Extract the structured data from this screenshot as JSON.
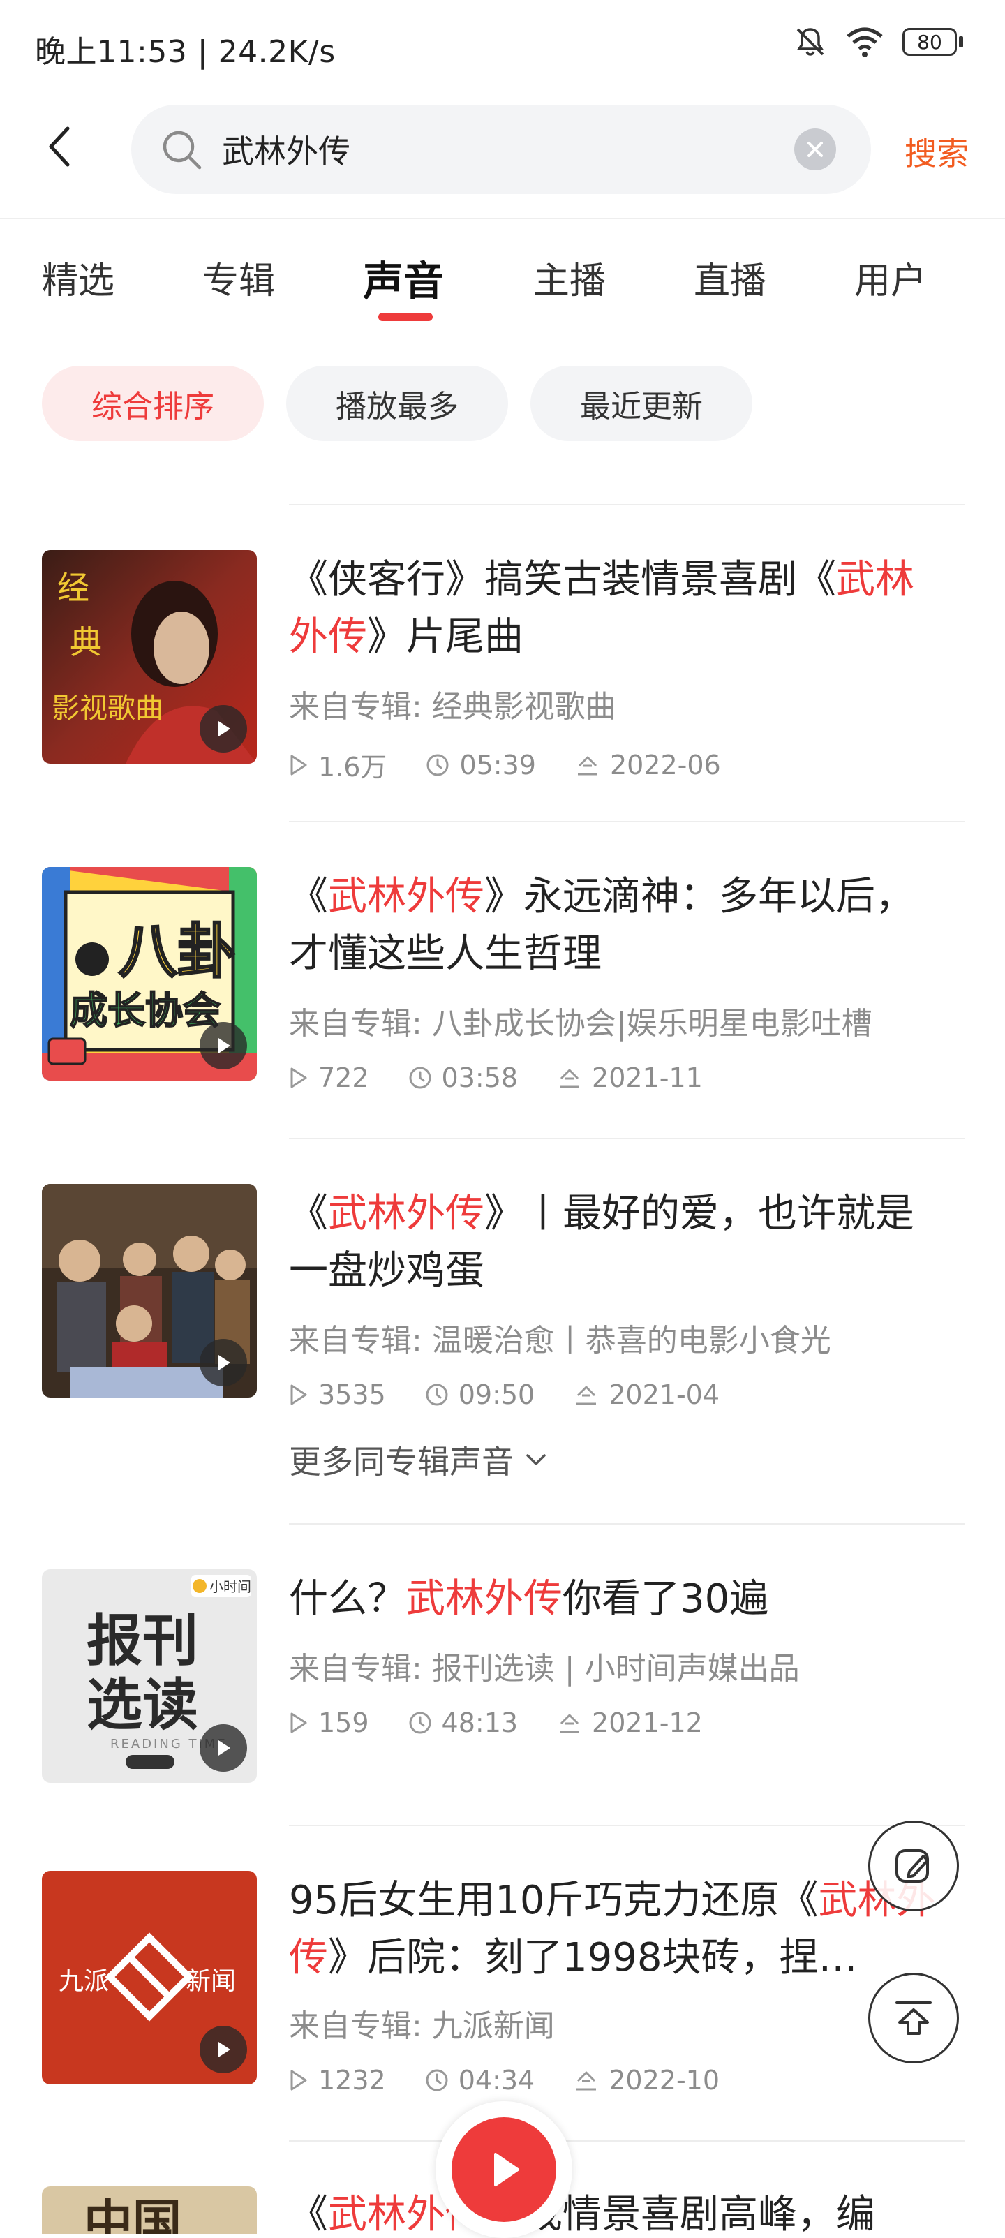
{
  "status_bar": {
    "time": "晚上11:53 | 24.2K/s",
    "battery": "80"
  },
  "search": {
    "query": "武林外传",
    "button": "搜索"
  },
  "tabs": [
    {
      "label": "精选",
      "active": false
    },
    {
      "label": "专辑",
      "active": false
    },
    {
      "label": "声音",
      "active": true
    },
    {
      "label": "主播",
      "active": false
    },
    {
      "label": "直播",
      "active": false
    },
    {
      "label": "用户",
      "active": false
    }
  ],
  "sort_chips": [
    {
      "label": "综合排序",
      "active": true
    },
    {
      "label": "播放最多",
      "active": false
    },
    {
      "label": "最近更新",
      "active": false
    }
  ],
  "tracks": [
    {
      "title_parts": [
        "《侠客行》搞笑古装情景喜剧《",
        "武林外传",
        "》片尾曲"
      ],
      "album": "来自专辑: 经典影视歌曲",
      "plays": "1.6万",
      "duration": "05:39",
      "date": "2022-06",
      "thumb_text": [
        "经",
        "典",
        "影视歌曲"
      ]
    },
    {
      "title_parts": [
        "《",
        "武林外传",
        "》永远滴神：多年以后，才懂这些人生哲理"
      ],
      "album": "来自专辑: 八卦成长协会|娱乐明星电影吐槽",
      "plays": "722",
      "duration": "03:58",
      "date": "2021-11",
      "thumb_text": [
        "八卦",
        "成长协会"
      ]
    },
    {
      "title_parts": [
        "《",
        "武林外传",
        "》丨最好的爱，也许就是一盘炒鸡蛋"
      ],
      "album": "来自专辑: 温暖治愈丨恭喜的电影小食光",
      "plays": "3535",
      "duration": "09:50",
      "date": "2021-04",
      "more": "更多同专辑声音"
    },
    {
      "title_parts": [
        "什么？",
        "武林外传",
        "你看了30遍"
      ],
      "album": "来自专辑: 报刊选读 | 小时间声媒出品",
      "plays": "159",
      "duration": "48:13",
      "date": "2021-12",
      "thumb_text": [
        "报刊",
        "选读",
        "READING TIME",
        "小时间"
      ]
    },
    {
      "title_parts": [
        "95后女生用10斤巧克力还原《",
        "武林外传",
        "》后院：刻了1998块砖，捏…"
      ],
      "album": "来自专辑: 九派新闻",
      "plays": "1232",
      "duration": "04:34",
      "date": "2022-10",
      "thumb_text": [
        "九派",
        "新闻"
      ]
    },
    {
      "title_parts": [
        "《",
        "武林外传",
        "》成情景喜剧高峰，编"
      ],
      "thumb_text": [
        "中国"
      ]
    }
  ],
  "colors": {
    "accent": "#ee3b3b",
    "search_orange": "#f25c20",
    "chip_bg": "#f3f4f6",
    "chip_active_bg": "#fdebeb"
  }
}
